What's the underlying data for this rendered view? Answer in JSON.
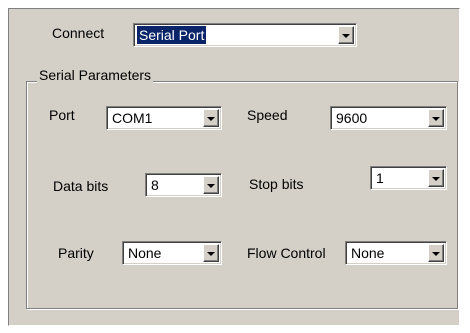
{
  "connect": {
    "label": "Connect",
    "value": "Serial Port"
  },
  "serial_parameters": {
    "title": "Serial Parameters",
    "port": {
      "label": "Port",
      "value": "COM1"
    },
    "speed": {
      "label": "Speed",
      "value": "9600"
    },
    "data_bits": {
      "label": "Data bits",
      "value": "8"
    },
    "stop_bits": {
      "label": "Stop bits",
      "value": "1"
    },
    "parity": {
      "label": "Parity",
      "value": "None"
    },
    "flow_control": {
      "label": "Flow Control",
      "value": "None"
    }
  },
  "icons": {
    "dropdown": "chevron-down-icon"
  },
  "colors": {
    "dialog_background": "#d4d0c8",
    "selection_highlight": "#0a246a"
  }
}
